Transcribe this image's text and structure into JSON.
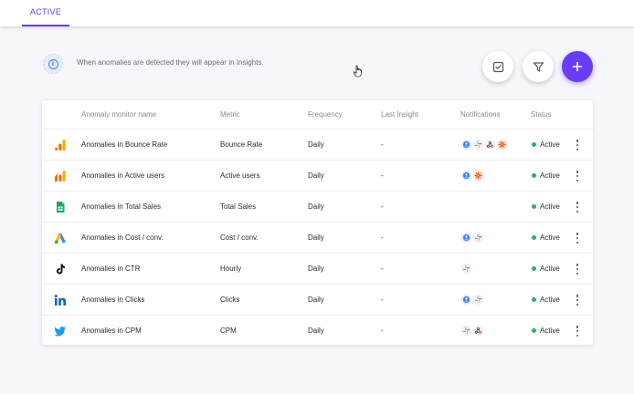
{
  "tabs": [
    {
      "label": "ACTIVE",
      "active": true
    }
  ],
  "info": {
    "text": "When anomalies are detected they will appear in Insights."
  },
  "actions": {
    "check_icon": "checklist-icon",
    "filter_icon": "filter-icon",
    "add_icon": "plus-icon"
  },
  "colors": {
    "accent": "#6b3cf6",
    "status_active": "#28b463"
  },
  "table": {
    "headers": [
      "Anomaly monitor name",
      "Metric",
      "Frequency",
      "Last Insight",
      "Notifications",
      "Status"
    ],
    "rows": [
      {
        "source": "google-analytics",
        "name": "Anomalies in Bounce Rate",
        "metric": "Bounce Rate",
        "frequency": "Daily",
        "last_insight": "-",
        "notifications": [
          "user",
          "slack",
          "webhook",
          "zapier"
        ],
        "status": "Active"
      },
      {
        "source": "google-analytics-4",
        "name": "Anomalies in Active users",
        "metric": "Active users",
        "frequency": "Daily",
        "last_insight": "-",
        "notifications": [
          "user",
          "zapier"
        ],
        "status": "Active"
      },
      {
        "source": "google-sheets",
        "name": "Anomalies in Total Sales",
        "metric": "Total Sales",
        "frequency": "Daily",
        "last_insight": "-",
        "notifications": [],
        "status": "Active"
      },
      {
        "source": "google-ads",
        "name": "Anomalies in Cost / conv.",
        "metric": "Cost / conv.",
        "frequency": "Daily",
        "last_insight": "-",
        "notifications": [
          "user",
          "slack"
        ],
        "status": "Active"
      },
      {
        "source": "tiktok",
        "name": "Anomalies in CTR",
        "metric": "Hourly",
        "frequency": "Daily",
        "last_insight": "-",
        "notifications": [
          "slack"
        ],
        "status": "Active"
      },
      {
        "source": "linkedin",
        "name": "Anomalies in Clicks",
        "metric": "Clicks",
        "frequency": "Daily",
        "last_insight": "-",
        "notifications": [
          "user",
          "slack"
        ],
        "status": "Active"
      },
      {
        "source": "twitter",
        "name": "Anomalies in CPM",
        "metric": "CPM",
        "frequency": "Daily",
        "last_insight": "-",
        "notifications": [
          "slack",
          "webhook"
        ],
        "status": "Active"
      }
    ]
  }
}
